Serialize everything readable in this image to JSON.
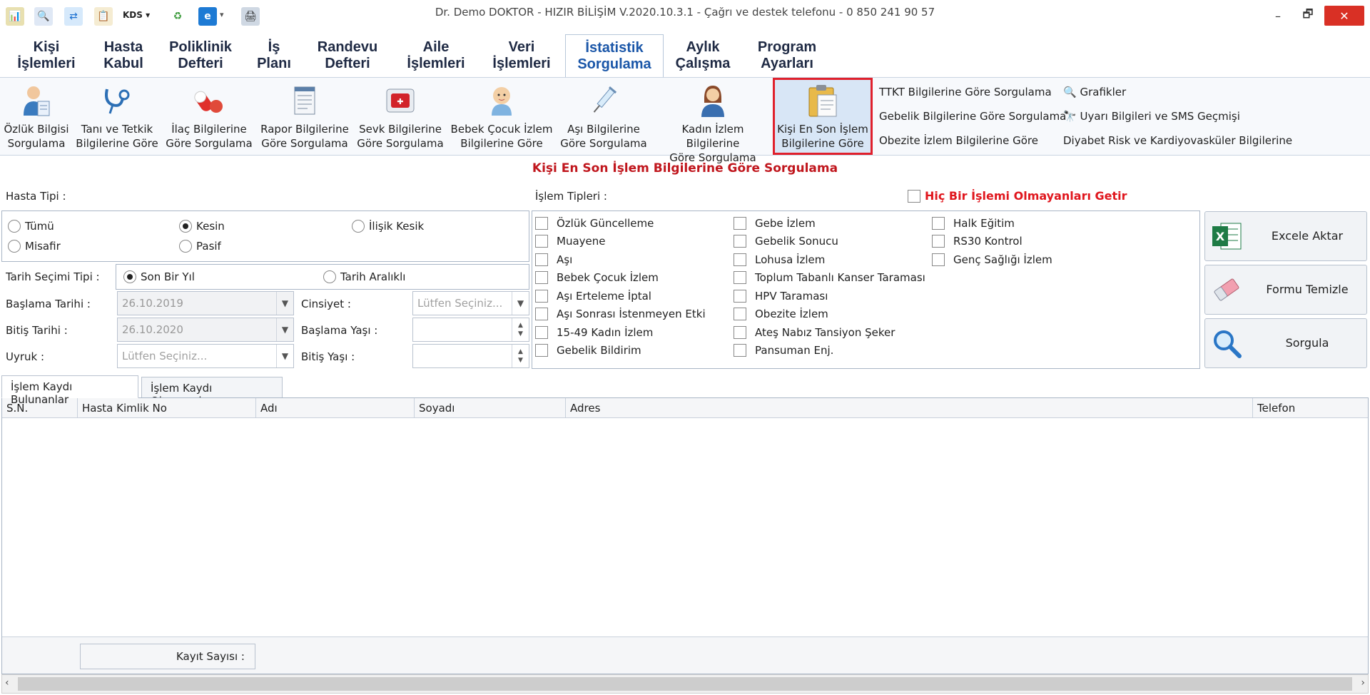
{
  "window": {
    "title": "Dr. Demo DOKTOR - HIZIR BİLİŞİM V.2020.10.3.1 - Çağrı ve destek telefonu - 0 850 241 90 57",
    "kds_label": "KDS"
  },
  "menu_tabs": [
    {
      "line1": "Kişi",
      "line2": "İşlemleri"
    },
    {
      "line1": "Hasta",
      "line2": "Kabul"
    },
    {
      "line1": "Poliklinik",
      "line2": "Defteri"
    },
    {
      "line1": "İş",
      "line2": "Planı"
    },
    {
      "line1": "Randevu",
      "line2": "Defteri"
    },
    {
      "line1": "Aile",
      "line2": "İşlemleri"
    },
    {
      "line1": "Veri",
      "line2": "İşlemleri"
    },
    {
      "line1": "İstatistik",
      "line2": "Sorgulama"
    },
    {
      "line1": "Aylık",
      "line2": "Çalışma"
    },
    {
      "line1": "Program",
      "line2": "Ayarları"
    }
  ],
  "ribbon": [
    {
      "line1": "Özlük Bilgisi",
      "line2": "Sorgulama",
      "icon": "person-doc-icon"
    },
    {
      "line1": "Tanı ve Tetkik",
      "line2": "Bilgilerine Göre",
      "icon": "stethoscope-icon"
    },
    {
      "line1": "İlaç Bilgilerine",
      "line2": "Göre Sorgulama",
      "icon": "pills-icon"
    },
    {
      "line1": "Rapor Bilgilerine",
      "line2": "Göre Sorgulama",
      "icon": "report-icon"
    },
    {
      "line1": "Sevk Bilgilerine",
      "line2": "Göre Sorgulama",
      "icon": "ambulance-icon"
    },
    {
      "line1": "Bebek Çocuk İzlem",
      "line2": "Bilgilerine Göre",
      "icon": "baby-icon"
    },
    {
      "line1": "Aşı Bilgilerine",
      "line2": "Göre Sorgulama",
      "icon": "syringe-icon"
    },
    {
      "line1": "Kadın İzlem Bilgilerine",
      "line2": "Göre Sorgulama",
      "icon": "woman-icon"
    },
    {
      "line1": "Kişi En Son İşlem",
      "line2": "Bilgilerine Göre",
      "icon": "clipboard-icon"
    }
  ],
  "ribbon_links_col1": [
    "TTKT Bilgilerine Göre Sorgulama",
    "Gebelik Bilgilerine Göre Sorgulama",
    "Obezite İzlem Bilgilerine Göre"
  ],
  "ribbon_links_col2": [
    "Grafikler",
    "Uyarı Bilgileri ve SMS Geçmişi",
    "Diyabet Risk ve Kardiyovasküler Bilgilerine"
  ],
  "section_title": "Kişi En Son İşlem Bilgilerine Göre Sorgulama",
  "filters": {
    "hasta_tipi_label": "Hasta Tipi :",
    "hasta_tipi_options": [
      "Tümü",
      "Kesin",
      "İlişik Kesik",
      "Misafir",
      "Pasif"
    ],
    "hasta_tipi_selected": "Kesin",
    "tarih_secimi_label": "Tarih Seçimi Tipi :",
    "tarih_options": [
      "Son Bir Yıl",
      "Tarih Aralıklı"
    ],
    "tarih_selected": "Son Bir Yıl",
    "baslama_tarihi_label": "Başlama Tarihi :",
    "baslama_tarihi_value": "26.10.2019",
    "bitis_tarihi_label": "Bitiş Tarihi :",
    "bitis_tarihi_value": "26.10.2020",
    "uyruk_label": "Uyruk :",
    "uyruk_placeholder": "Lütfen Seçiniz...",
    "cinsiyet_label": "Cinsiyet :",
    "cinsiyet_placeholder": "Lütfen Seçiniz...",
    "baslama_yasi_label": "Başlama Yaşı :",
    "bitis_yasi_label": "Bitiş Yaşı :"
  },
  "islem_tipleri": {
    "label": "İşlem Tipleri :",
    "none_option": "Hiç Bir İşlemi Olmayanları Getir",
    "col1": [
      "Özlük Güncelleme",
      "Muayene",
      "Aşı",
      "Bebek Çocuk İzlem",
      "Aşı Erteleme İptal",
      "Aşı Sonrası İstenmeyen Etki",
      "15-49 Kadın İzlem",
      "Gebelik Bildirim"
    ],
    "col2": [
      "Gebe İzlem",
      "Gebelik Sonucu",
      "Lohusa İzlem",
      "Toplum Tabanlı Kanser Taraması",
      "HPV Taraması",
      "Obezite İzlem",
      "Ateş Nabız Tansiyon Şeker",
      "Pansuman Enj."
    ],
    "col3": [
      "Halk Eğitim",
      "RS30 Kontrol",
      "Genç Sağlığı İzlem"
    ]
  },
  "actions": {
    "excel": "Excele Aktar",
    "clear": "Formu Temizle",
    "query": "Sorgula"
  },
  "grid_tabs": [
    "İşlem Kaydı Bulunanlar",
    "İşlem Kaydı Olmayanlar"
  ],
  "grid_columns": [
    "S.N.",
    "Hasta Kimlik No",
    "Adı",
    "Soyadı",
    "Adres",
    "Telefon"
  ],
  "footer": {
    "count_label": "Kayıt Sayısı :"
  },
  "colors": {
    "accent": "#1a56a8",
    "alert_red": "#c0161d",
    "selected_bg": "#d8e6f6"
  }
}
